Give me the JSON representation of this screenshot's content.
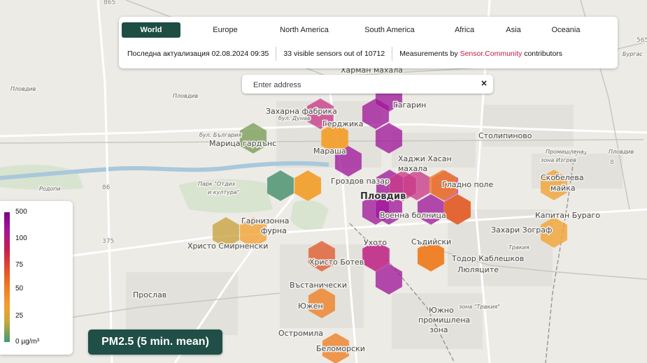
{
  "tabs": [
    {
      "label": "World",
      "active": true
    },
    {
      "label": "Europe"
    },
    {
      "label": "North America"
    },
    {
      "label": "South America"
    },
    {
      "label": "Africa"
    },
    {
      "label": "Asia"
    },
    {
      "label": "Oceania"
    }
  ],
  "info": {
    "last_update_label": "Последна актуализация 02.08.2024 09:35",
    "visible_count": "33",
    "visible_text": "visible sensors out of",
    "total_count": "10712",
    "measurements_prefix": "Measurements by",
    "community_link": "Sensor.Community",
    "measurements_suffix": "contributors"
  },
  "search": {
    "placeholder": "Enter address",
    "value": "",
    "clear": "×"
  },
  "legend": {
    "labels": [
      "500",
      "100",
      "75",
      "50",
      "25",
      "0 µg/m³"
    ],
    "colors": {
      "purple": "#800080",
      "red": "#c61c52",
      "orange": "#ee7e22",
      "yellow": "#f2a030",
      "green": "#3f9b74"
    }
  },
  "pm_badge": "PM2.5 (5 min. mean)",
  "map": {
    "labels": [
      "Харман махала",
      "Захарна фабрика",
      "Гагарин",
      "Герджика",
      "Марица гардънс",
      "Мараша",
      "Столипиново",
      "Хаджи Хасан",
      "махала",
      "Гроздов пазар",
      "Пловдив",
      "Гладно поле",
      "Скобелева",
      "майка",
      "Военна болница",
      "Гарнизонна",
      "фурна",
      "Капитан Бураго",
      "Христо Смирненски",
      "Захари Зограф",
      "Ухото",
      "Съдийски",
      "Христо Ботев",
      "Тодор Каблешков",
      "Люляците",
      "Въстанически",
      "Прослав",
      "Южен",
      "Остромила",
      "Беломорски",
      "Изгрев",
      "Южно",
      "промишлена",
      "зона",
      "Промишлена",
      "зона Изгрев",
      "зона \"Тракия\"",
      "Тракия",
      "Парк \"Отдих",
      "и култура\"",
      "Родопи",
      "бул. България",
      "бул. Дунав",
      "Пловдив",
      "865",
      "86",
      "8",
      "375",
      "565",
      "Бургас",
      "Пловдив",
      "Пловдив"
    ],
    "hex_values": [
      {
        "value": 75
      },
      {
        "value": 120
      },
      {
        "value": 30
      },
      {
        "value": 110
      },
      {
        "value": 12
      },
      {
        "value": 28
      },
      {
        "value": 130
      },
      {
        "value": 150
      },
      {
        "value": 140
      },
      {
        "value": 80
      },
      {
        "value": 95
      },
      {
        "value": 150
      },
      {
        "value": 45
      },
      {
        "value": 8
      },
      {
        "value": 22
      },
      {
        "value": 35
      },
      {
        "value": 32
      },
      {
        "value": 35
      },
      {
        "value": 130
      },
      {
        "value": 85
      },
      {
        "value": 120
      },
      {
        "value": 35
      },
      {
        "value": 50
      },
      {
        "value": 70
      },
      {
        "value": 120
      },
      {
        "value": 45
      },
      {
        "value": 40
      },
      {
        "value": 45
      },
      {
        "value": 95
      },
      {
        "value": 110
      },
      {
        "value": 60
      },
      {
        "value": 25
      },
      {
        "value": 55
      }
    ]
  }
}
